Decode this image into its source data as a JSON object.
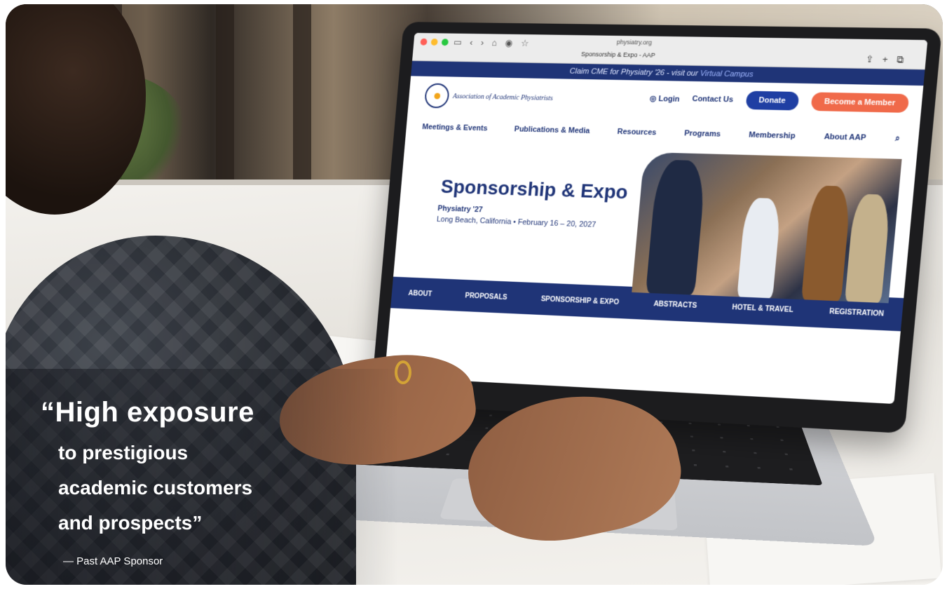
{
  "browser": {
    "url": "physiatry.org",
    "tab_title": "Sponsorship & Expo - AAP"
  },
  "site": {
    "cme_banner_prefix": "Claim CME for Physiatry '26 - visit our",
    "cme_banner_link": "Virtual Campus",
    "logo_text": "Association of Academic Physiatrists",
    "login_label": "Login",
    "contact_label": "Contact Us",
    "donate_label": "Donate",
    "member_label": "Become a Member",
    "nav": [
      "Meetings & Events",
      "Publications & Media",
      "Resources",
      "Programs",
      "Membership",
      "About AAP"
    ],
    "hero": {
      "title": "Sponsorship & Expo",
      "subtitle": "Physiatry '27",
      "date": "Long Beach, California • February 16 – 20, 2027"
    },
    "subnav": [
      "ABOUT",
      "PROPOSALS",
      "SPONSORSHIP & EXPO",
      "ABSTRACTS",
      "HOTEL & TRAVEL",
      "REGISTRATION"
    ],
    "language": "EN"
  },
  "quote": {
    "line1": "“High exposure",
    "line2": "to prestigious",
    "line3": "academic customers",
    "line4": "and prospects”",
    "attribution": "— Past AAP Sponsor"
  },
  "colors": {
    "brand_navy": "#1f3477",
    "donate_blue": "#1f3fa3",
    "member_orange": "#f06a4a"
  }
}
